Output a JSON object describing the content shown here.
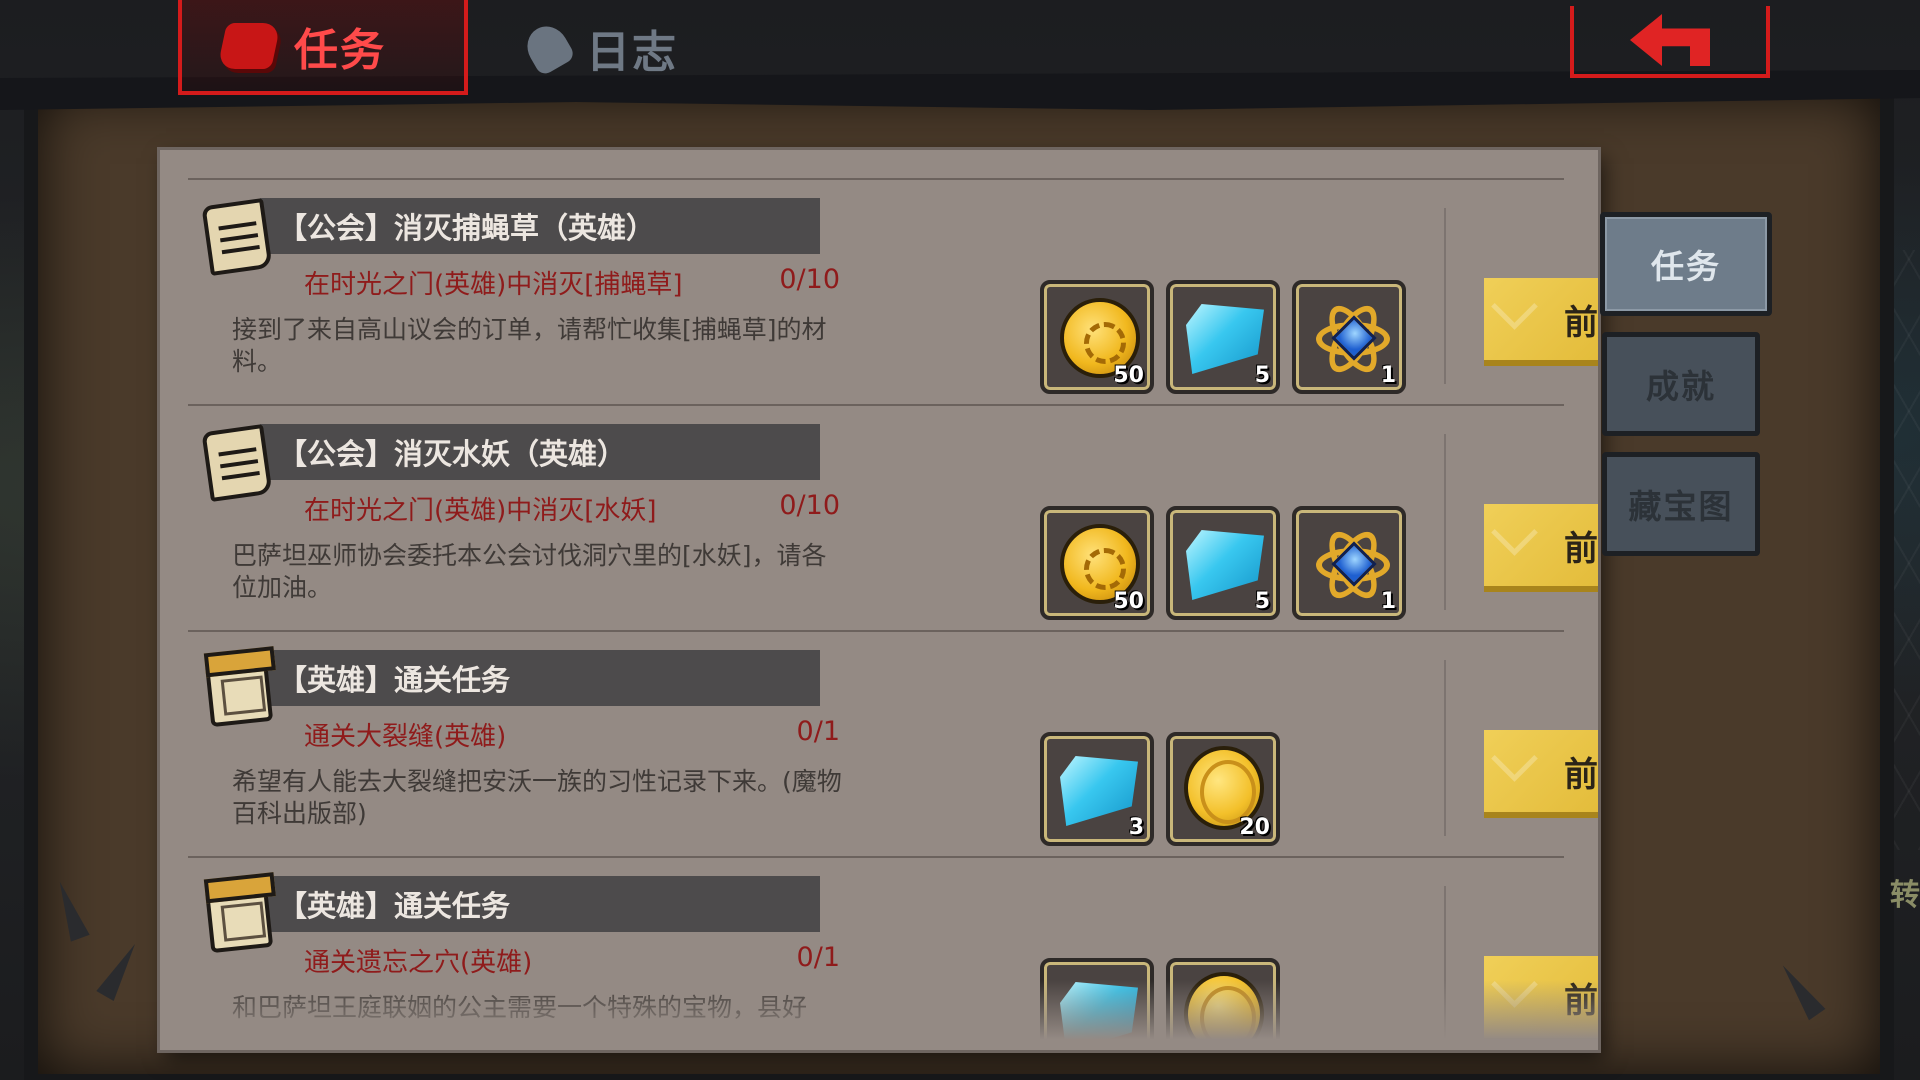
{
  "top_tabs": {
    "quests_label": "任务",
    "log_label": "日志"
  },
  "side_tabs": [
    {
      "label": "任务",
      "active": true
    },
    {
      "label": "成就",
      "active": false
    },
    {
      "label": "藏宝图",
      "active": false
    }
  ],
  "quests": [
    {
      "title": "【公会】消灭捕蝇草（英雄）",
      "icon": "scroll-icon",
      "objective": "在时光之门(英雄)中消灭[捕蝇草]",
      "progress": "0/10",
      "description": "接到了来自高山议会的订单，请帮忙收集[捕蝇草]的材料。",
      "rewards": [
        {
          "item": "gold-gear-coin",
          "count": "50"
        },
        {
          "item": "blue-crystal",
          "count": "5"
        },
        {
          "item": "sapphire-atom",
          "count": "1"
        }
      ],
      "button": "前往"
    },
    {
      "title": "【公会】消灭水妖（英雄）",
      "icon": "scroll-icon",
      "objective": "在时光之门(英雄)中消灭[水妖]",
      "progress": "0/10",
      "description": "巴萨坦巫师协会委托本公会讨伐洞穴里的[水妖]，请各位加油。",
      "rewards": [
        {
          "item": "gold-gear-coin",
          "count": "50"
        },
        {
          "item": "blue-crystal",
          "count": "5"
        },
        {
          "item": "sapphire-atom",
          "count": "1"
        }
      ],
      "button": "前往"
    },
    {
      "title": "【英雄】通关任务",
      "icon": "calendar-icon",
      "objective": "通关大裂缝(英雄)",
      "progress": "0/1",
      "description": "希望有人能去大裂缝把安沃一族的习性记录下来。(魔物百科出版部)",
      "rewards": [
        {
          "item": "blue-crystal",
          "count": "3"
        },
        {
          "item": "gold-coin",
          "count": "20"
        }
      ],
      "button": "前往"
    },
    {
      "title": "【英雄】通关任务",
      "icon": "calendar-icon",
      "objective": "通关遗忘之穴(英雄)",
      "progress": "0/1",
      "description": "和巴萨坦王庭联姻的公主需要一个特殊的宝物，县好",
      "rewards": [
        {
          "item": "blue-crystal",
          "count": ""
        },
        {
          "item": "gold-coin",
          "count": ""
        }
      ],
      "button": "前往"
    }
  ],
  "edge_text": "转",
  "colors": {
    "accent_red": "#d41b1b",
    "objective_red": "#8f1b1b",
    "button_gold": "#e4bd3c",
    "panel": "#948a84"
  }
}
